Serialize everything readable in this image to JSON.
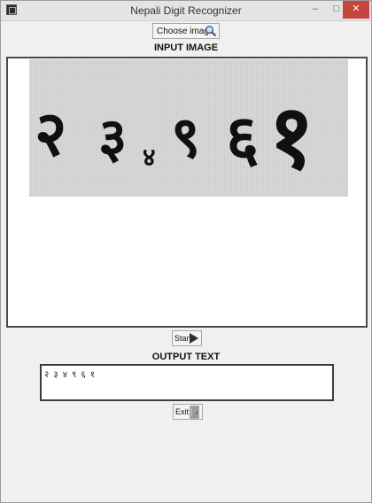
{
  "window": {
    "title": "Nepali Digit Recognizer"
  },
  "controls": {
    "choose_image_label": "Choose image",
    "start_label": "Start",
    "exit_label": "Exit"
  },
  "labels": {
    "input_image": "INPUT IMAGE",
    "output_text": "OUTPUT TEXT"
  },
  "input_image": {
    "digits": [
      "२",
      "३",
      "४",
      "९",
      "६",
      "१"
    ]
  },
  "output": {
    "text": "२ ३ ४ ९ ६ १"
  },
  "icons": {
    "app": "app-icon",
    "choose": "magnifier-icon",
    "start": "play-arrow-icon",
    "exit": "door-exit-icon"
  },
  "colors": {
    "close_button": "#c5453c",
    "panel_border": "#4a4a4a"
  }
}
